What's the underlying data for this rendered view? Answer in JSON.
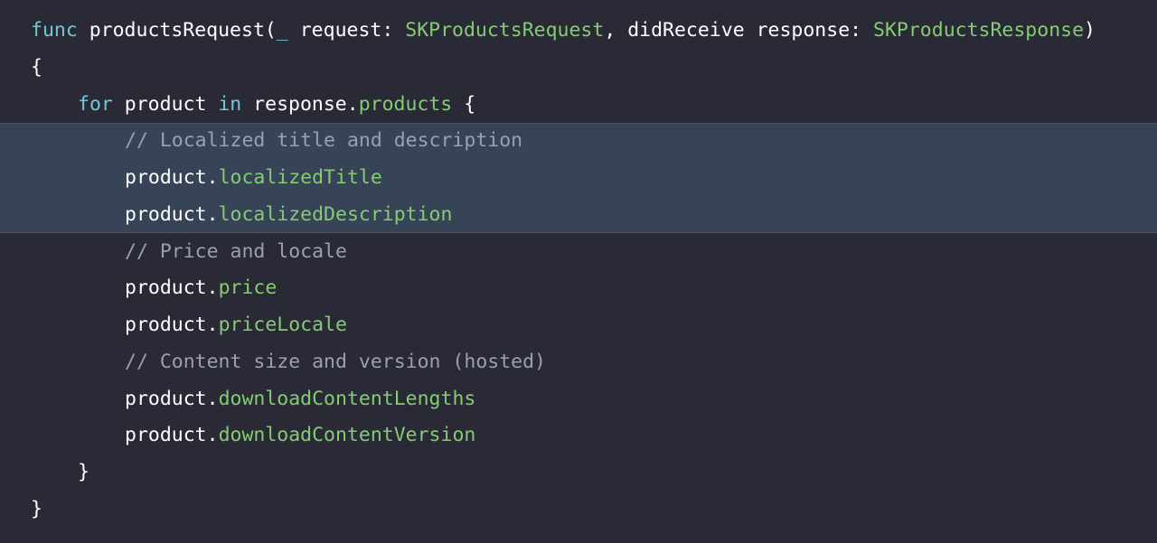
{
  "code": {
    "line1": {
      "kw_func": "func",
      "name": " productsRequest(",
      "underscore": "_",
      "param1": " request: ",
      "type1": "SKProductsRequest",
      "param2": ", didReceive response: ",
      "type2": "SKProductsResponse",
      "close": ")"
    },
    "line2": {
      "brace": "{"
    },
    "line3": {
      "kw_for": "for",
      "product": " product ",
      "kw_in": "in",
      "response": " response.",
      "products": "products",
      "brace": " {"
    },
    "line4": {
      "comment": "// Localized title and description"
    },
    "line5": {
      "obj": "product.",
      "prop": "localizedTitle"
    },
    "line6": {
      "obj": "product.",
      "prop": "localizedDescription"
    },
    "line7": {
      "comment": "// Price and locale"
    },
    "line8": {
      "obj": "product.",
      "prop": "price"
    },
    "line9": {
      "obj": "product.",
      "prop": "priceLocale"
    },
    "line10": {
      "comment": "// Content size and version (hosted)"
    },
    "line11": {
      "obj": "product.",
      "prop": "downloadContentLengths"
    },
    "line12": {
      "obj": "product.",
      "prop": "downloadContentVersion"
    },
    "line13": {
      "brace": "}"
    },
    "line14": {
      "brace": "}"
    }
  },
  "colors": {
    "background": "#292a35",
    "highlight": "#374357",
    "keyword": "#6fc9d8",
    "type": "#84cc72",
    "comment": "#9d9fb0",
    "plain": "#ffffff"
  }
}
